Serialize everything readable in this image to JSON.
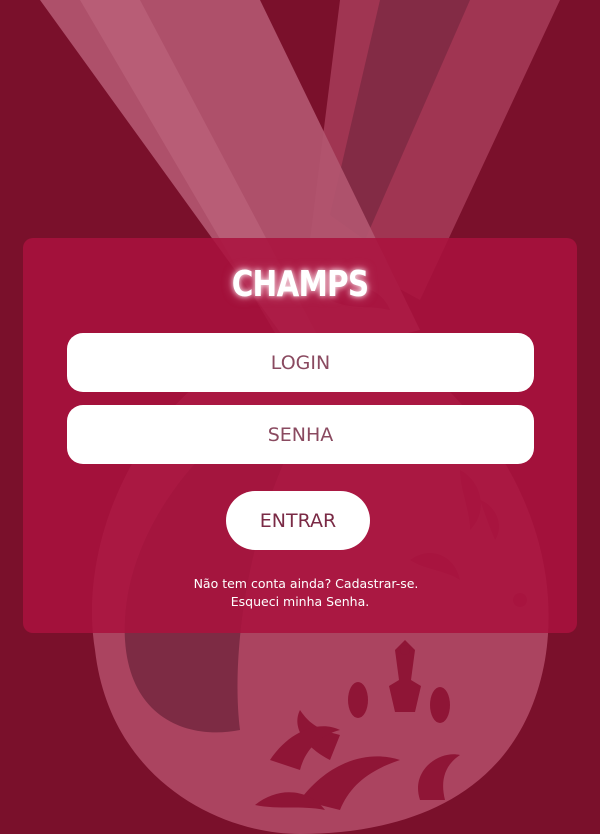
{
  "app": {
    "logo_text": "CHAMPS"
  },
  "form": {
    "login_placeholder": "LOGIN",
    "password_placeholder": "SENHA",
    "submit_label": "ENTRAR"
  },
  "links": {
    "signup": "Não tem conta ainda? Cadastrar-se.",
    "forgot_password": "Esqueci minha Senha."
  },
  "colors": {
    "background": "#7a102b",
    "card": "#aa123e",
    "field": "#ffffff",
    "field_text": "#7a2a45"
  },
  "decoration": {
    "background_art": "medal-ribbon-illustration"
  }
}
